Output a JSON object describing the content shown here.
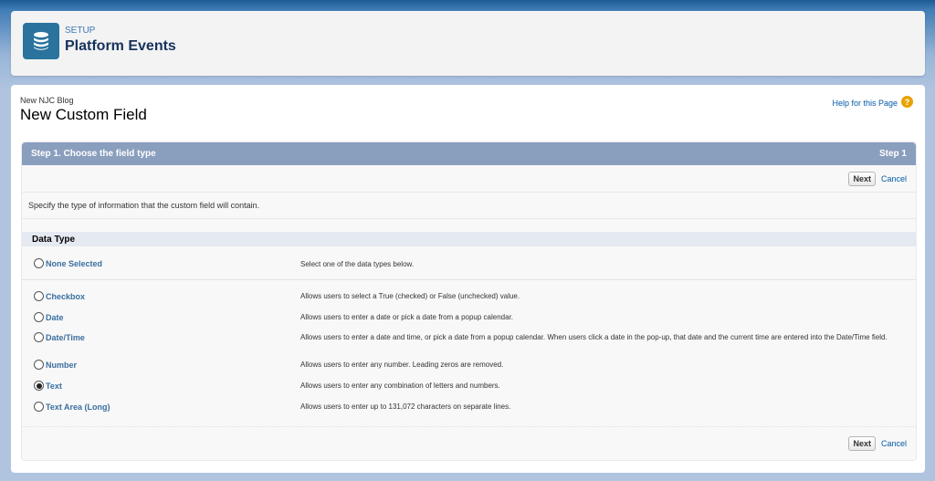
{
  "header": {
    "eyebrow": "SETUP",
    "title": "Platform Events",
    "icon": "database-icon",
    "icon_color": "#2a739e"
  },
  "page": {
    "breadcrumb": "New NJC Blog",
    "title": "New Custom Field",
    "help_link": "Help for this Page",
    "help_icon": "?"
  },
  "step": {
    "title": "Step 1. Choose the field type",
    "indicator": "Step 1",
    "header_color": "#8a9ebe",
    "next_label": "Next",
    "cancel_label": "Cancel",
    "instructions": "Specify the type of information that the custom field will contain."
  },
  "data_type": {
    "section_title": "Data Type",
    "none_option": {
      "label": "None Selected",
      "description": "Select one of the data types below.",
      "checked": false
    },
    "options": [
      {
        "label": "Checkbox",
        "description": "Allows users to select a True (checked) or False (unchecked) value.",
        "checked": false
      },
      {
        "label": "Date",
        "description": "Allows users to enter a date or pick a date from a popup calendar.",
        "checked": false
      },
      {
        "label": "Date/Time",
        "description": "Allows users to enter a date and time, or pick a date from a popup calendar. When users click a date in the pop-up, that date and the current time are entered into the Date/Time field.",
        "checked": false
      },
      {
        "label": "Number",
        "description": "Allows users to enter any number. Leading zeros are removed.",
        "checked": false
      },
      {
        "label": "Text",
        "description": "Allows users to enter any combination of letters and numbers.",
        "checked": true
      },
      {
        "label": "Text Area (Long)",
        "description": "Allows users to enter up to 131,072 characters on separate lines.",
        "checked": false
      }
    ]
  }
}
